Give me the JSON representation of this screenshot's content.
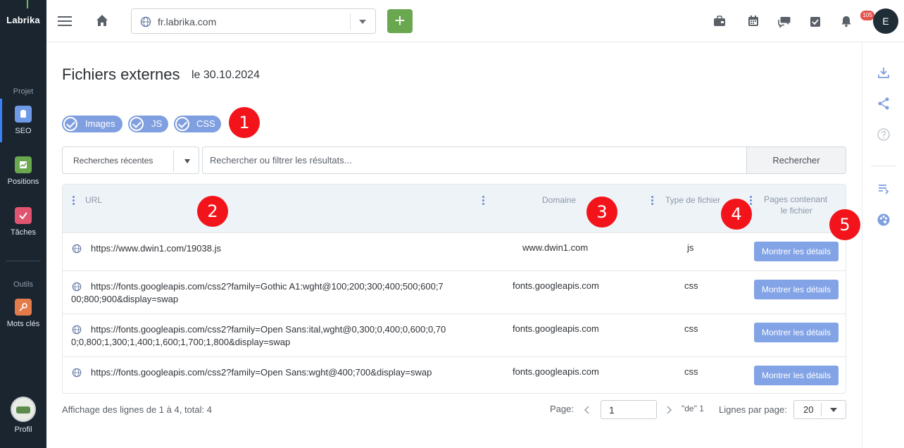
{
  "colors": {
    "sidebar_bg": "#1a2530",
    "accent_green": "#6aa84f",
    "chip_blue": "#7f9fe0",
    "button_blue": "#82a3e6",
    "marker_red": "#f2141a",
    "badge_red": "#e5534b"
  },
  "sidebar": {
    "logo": "Labrika",
    "section_project": "Projet",
    "section_tools": "Outils",
    "items": [
      {
        "label": "SEO",
        "icon": "clipboard-icon",
        "color": "#6f9ae8"
      },
      {
        "label": "Positions",
        "icon": "chart-icon",
        "color": "#6aa84f"
      },
      {
        "label": "Tâches",
        "icon": "check-icon",
        "color": "#e0546f"
      },
      {
        "label": "Mots clés",
        "icon": "key-icon",
        "color": "#e47b4a"
      }
    ],
    "profile_label": "Profil"
  },
  "topbar": {
    "site": "fr.labrika.com",
    "add_label": "+",
    "badge_count": "105",
    "user_initial": "E"
  },
  "header": {
    "title": "Fichiers externes",
    "date": "le 30.10.2024"
  },
  "filters": {
    "chips": [
      "Images",
      "JS",
      "CSS"
    ]
  },
  "search": {
    "recent_label": "Recherches récentes",
    "placeholder": "Rechercher ou filtrer les résultats...",
    "button": "Rechercher"
  },
  "table": {
    "headers": {
      "url": "URL",
      "domain": "Domaine",
      "type": "Type de fichier",
      "pages_1": "Pages contenant",
      "pages_2": "le fichier"
    },
    "rows": [
      {
        "url_1": "https://www.dwin1.com/19038.js",
        "url_2": "",
        "domain": "www.dwin1.com",
        "type": "js",
        "action": "Montrer les détails"
      },
      {
        "url_1": "https://fonts.googleapis.com/css2?family=Gothic A1:wght@100;200;300;400;500;600;7",
        "url_2": "00;800;900&display=swap",
        "domain": "fonts.googleapis.com",
        "type": "css",
        "action": "Montrer les détails"
      },
      {
        "url_1": "https://fonts.googleapis.com/css2?family=Open Sans:ital,wght@0,300;0,400;0,600;0,70",
        "url_2": "0;0,800;1,300;1,400;1,600;1,700;1,800&display=swap",
        "domain": "fonts.googleapis.com",
        "type": "css",
        "action": "Montrer les détails"
      },
      {
        "url_1": "https://fonts.googleapis.com/css2?family=Open Sans:wght@400;700&display=swap",
        "url_2": "",
        "domain": "fonts.googleapis.com",
        "type": "css",
        "action": "Montrer les détails"
      }
    ]
  },
  "markers": [
    "1",
    "2",
    "3",
    "4",
    "5"
  ],
  "footer": {
    "info": "Affichage des lignes de 1 à 4, total: 4",
    "page_label": "Page:",
    "page_value": "1",
    "page_of": "\"de\" 1",
    "rows_label": "Lignes par page:",
    "rows_value": "20"
  }
}
